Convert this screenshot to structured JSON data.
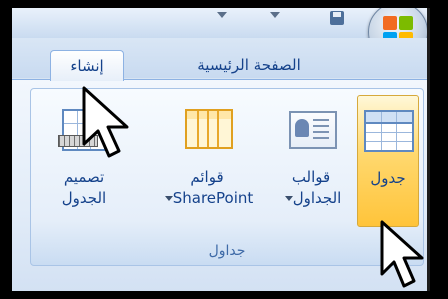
{
  "ribbon": {
    "tabs": [
      {
        "label": "الصفحة الرئيسية",
        "active": false
      },
      {
        "label": "إنشاء",
        "active": true
      }
    ],
    "group": {
      "label": "جداول",
      "buttons": [
        {
          "line1": "جدول",
          "line2": "",
          "icon": "table-icon",
          "highlighted": true
        },
        {
          "line1": "قوالب",
          "line2": "الجداول",
          "icon": "contact-card-icon",
          "dropdown": true
        },
        {
          "line1": "قوائم",
          "line2": "SharePoint",
          "icon": "sharepoint-list-icon",
          "dropdown": true
        },
        {
          "line1": "تصميم",
          "line2": "الجدول",
          "icon": "table-design-icon"
        }
      ]
    }
  },
  "colors": {
    "accent": "#15428b",
    "highlight": "#ffc43a",
    "ribbon_bg": "#e2ecf8"
  }
}
